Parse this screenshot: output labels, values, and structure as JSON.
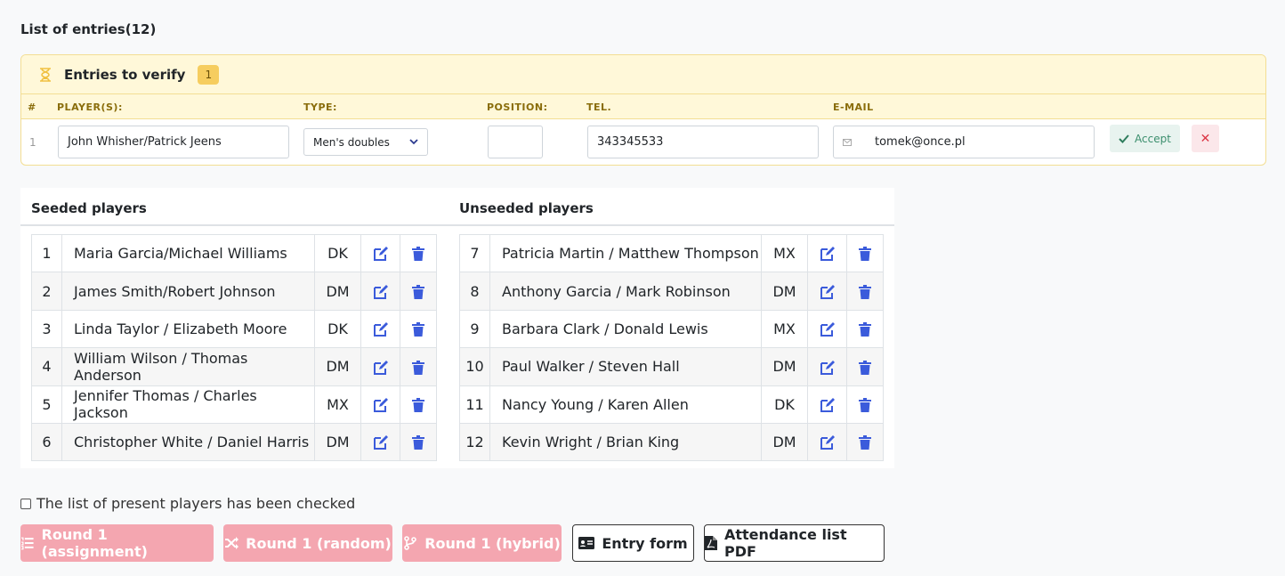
{
  "page": {
    "title": "List of entries(12)"
  },
  "verify": {
    "title": "Entries to verify",
    "count": "1",
    "columns": {
      "num": "#",
      "players": "PLAYER(S):",
      "type": "TYPE:",
      "position": "POSITION:",
      "tel": "TEL.",
      "email": "E-MAIL"
    },
    "row": {
      "index": "1",
      "players": "John Whisher/Patrick Jeens",
      "type": "Men's doubles",
      "position": "",
      "tel": "343345533",
      "email": "tomek@once.pl"
    },
    "accept_label": "Accept",
    "reject_label": "✕"
  },
  "seeded": {
    "title": "Seeded players",
    "rows": [
      {
        "num": "1",
        "name": "Maria Garcia/Michael Williams",
        "type": "DK"
      },
      {
        "num": "2",
        "name": "James Smith/Robert Johnson",
        "type": "DM"
      },
      {
        "num": "3",
        "name": "Linda Taylor / Elizabeth Moore",
        "type": "DK"
      },
      {
        "num": "4",
        "name": "William Wilson / Thomas Anderson",
        "type": "DM"
      },
      {
        "num": "5",
        "name": "Jennifer Thomas / Charles Jackson",
        "type": "MX"
      },
      {
        "num": "6",
        "name": "Christopher White / Daniel Harris",
        "type": "DM"
      }
    ]
  },
  "unseeded": {
    "title": "Unseeded players",
    "rows": [
      {
        "num": "7",
        "name": "Patricia Martin / Matthew Thompson",
        "type": "MX"
      },
      {
        "num": "8",
        "name": "Anthony Garcia / Mark Robinson",
        "type": "DM"
      },
      {
        "num": "9",
        "name": "Barbara Clark / Donald Lewis",
        "type": "MX"
      },
      {
        "num": "10",
        "name": "Paul Walker / Steven Hall",
        "type": "DM"
      },
      {
        "num": "11",
        "name": "Nancy Young / Karen Allen",
        "type": "DK"
      },
      {
        "num": "12",
        "name": "Kevin Wright / Brian King",
        "type": "DM"
      }
    ]
  },
  "checkbox": {
    "label": "The list of present players has been checked",
    "checked": false
  },
  "buttons": {
    "round_assignment": "Round 1 (assignment)",
    "round_random": "Round 1 (random)",
    "round_hybrid": "Round 1 (hybrid)",
    "entry_form": "Entry form",
    "attendance_pdf": "Attendance list PDF"
  },
  "colors": {
    "accent_blue": "#3b5bdb",
    "pink_button": "#f4a6b0",
    "warning_bg": "#fff8d9"
  }
}
